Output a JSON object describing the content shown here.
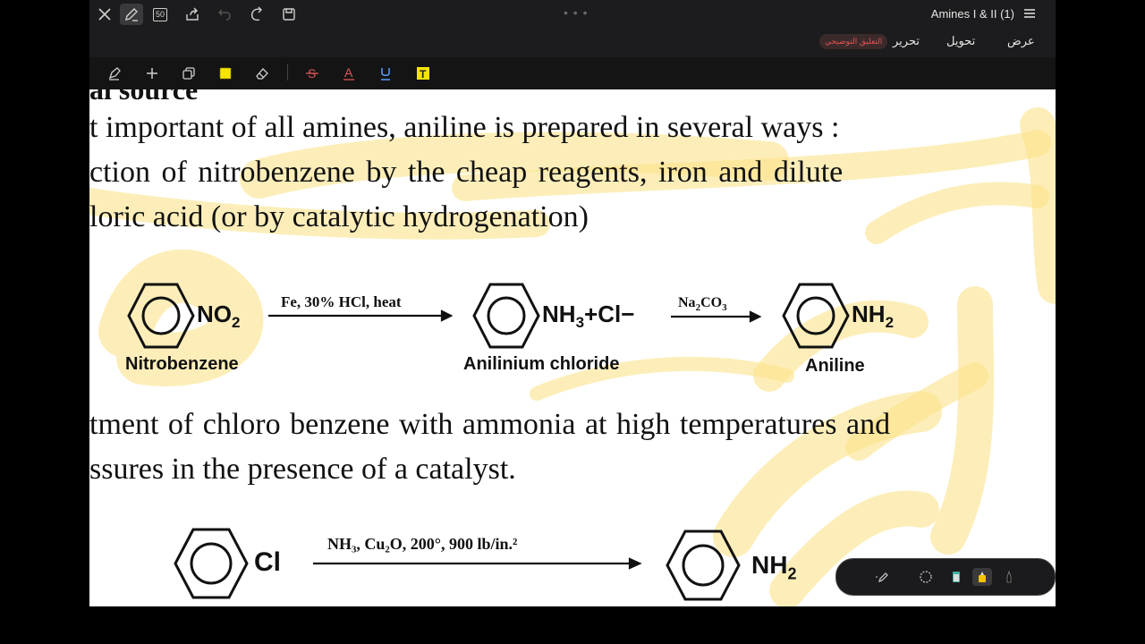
{
  "app": {
    "doc_title": "Amines I & II (1)",
    "page_count_badge": "50"
  },
  "tabs": [
    {
      "label": "عرض"
    },
    {
      "label": "تحويل"
    },
    {
      "label": "تحرير"
    },
    {
      "label": "التعليق التوضيحي"
    }
  ],
  "document": {
    "partial_heading": "al source",
    "lines": [
      "t important of all amines, aniline is prepared in several ways :",
      "ction  of  nitrobenzene  by  the  cheap  reagents,  iron  and  dilute",
      "loric acid (or by catalytic hydrogenation)",
      "tment of chloro benzene with ammonia at high temperatures and",
      "ssures in the presence of a catalyst."
    ],
    "reaction1": {
      "reactant_sub": "NO",
      "reactant_sub_index": "2",
      "reactant_name": "Nitrobenzene",
      "condition1": "Fe, 30% HCl, heat",
      "intermediate_a": "NH",
      "intermediate_b": "3",
      "intermediate_c": "+Cl−",
      "intermediate_name": "Anilinium chloride",
      "condition2_a": "Na",
      "condition2_b": "2",
      "condition2_c": "CO",
      "condition2_d": "3",
      "product_a": "NH",
      "product_b": "2",
      "product_name": "Aniline"
    },
    "reaction2": {
      "reactant_sub": "Cl",
      "condition": "NH₃, Cu₂O, 200°, 900 lb/in.²",
      "product_a": "NH",
      "product_b": "2"
    }
  },
  "colors": {
    "highlighter": "#f9e27a",
    "accent_red": "#e05555",
    "toolbar_bg": "#1c1c1e"
  }
}
